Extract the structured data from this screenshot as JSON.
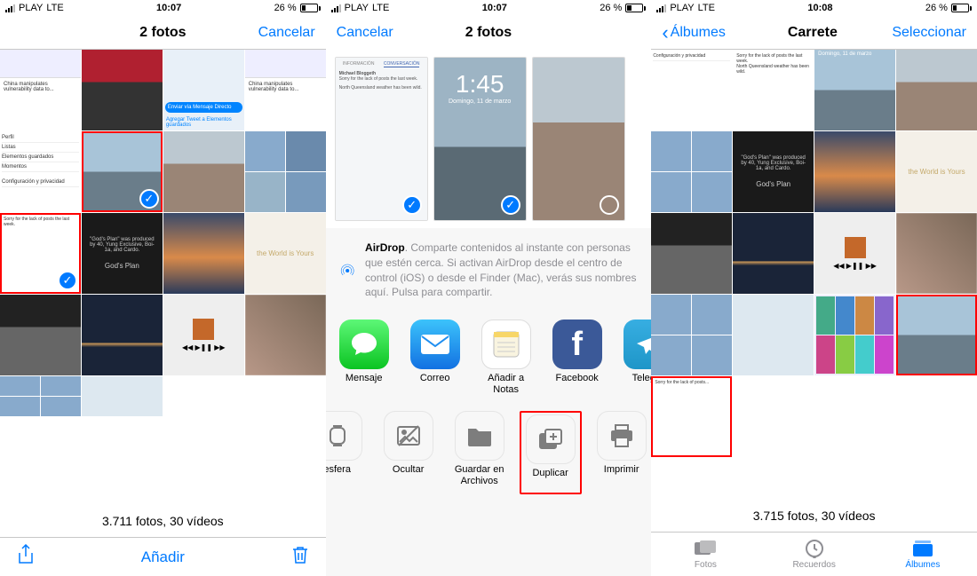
{
  "phone1": {
    "status": {
      "carrier": "PLAY",
      "network": "LTE",
      "time": "10:07",
      "battery_pct": "26 %"
    },
    "nav": {
      "title": "2 fotos",
      "cancel": "Cancelar"
    },
    "count": "3.711 fotos, 30 vídeos",
    "toolbar": {
      "add": "Añadir"
    },
    "gods_plan_text": "\"God's Plan\" was produced by 40, Yung Exclusive, Boi-1a, and Cardo.",
    "gods_plan_title": "God's Plan"
  },
  "phone2": {
    "status": {
      "carrier": "PLAY",
      "network": "LTE",
      "time": "10:07",
      "battery_pct": "26 %"
    },
    "nav": {
      "cancel": "Cancelar",
      "title": "2 fotos"
    },
    "lockscreen": {
      "time": "1:45",
      "date": "Domingo, 11 de marzo"
    },
    "airdrop": {
      "bold": "AirDrop",
      "text": ". Comparte contenidos al instante con personas que estén cerca. Si activan AirDrop desde el centro de control (iOS) o desde el Finder (Mac), verás sus nombres aquí. Pulsa para compartir."
    },
    "apps": {
      "message": "Mensaje",
      "mail": "Correo",
      "notes": "Añadir a Notas",
      "facebook": "Facebook",
      "telegram": "Telegra"
    },
    "actions": {
      "watchface": "esfera",
      "hide": "Ocultar",
      "save_files": "Guardar en Archivos",
      "duplicate": "Duplicar",
      "print": "Imprimir"
    }
  },
  "phone3": {
    "status": {
      "carrier": "PLAY",
      "network": "LTE",
      "time": "10:08",
      "battery_pct": "26 %"
    },
    "nav": {
      "back": "Álbumes",
      "title": "Carrete",
      "select": "Seleccionar"
    },
    "count": "3.715 fotos, 30 vídeos",
    "tabs": {
      "photos": "Fotos",
      "memories": "Recuerdos",
      "albums": "Álbumes"
    },
    "gods_plan_text": "\"God's Plan\" was produced by 40, Yung Exclusive, Boi-1a, and Cardo.",
    "gods_plan_title": "God's Plan",
    "lockscreen_date": "Domingo, 11 de marzo"
  }
}
